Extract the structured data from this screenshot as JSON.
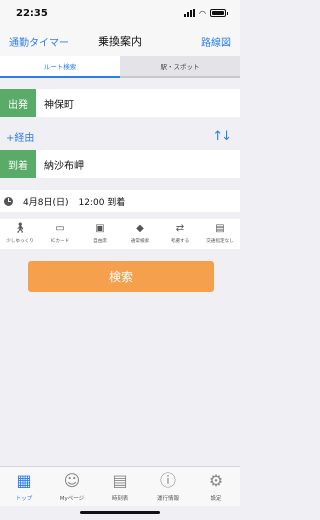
{
  "status_bar": {
    "time": "22:35"
  },
  "nav": {
    "left": "通勤タイマー",
    "title": "乗換案内",
    "right": "路線図"
  },
  "tabs": [
    {
      "label": "ルート検索",
      "active": true
    },
    {
      "label": "駅・スポット",
      "active": false
    }
  ],
  "departure": {
    "badge": "出発",
    "value": "神保町"
  },
  "via": {
    "label": "+経由"
  },
  "arrival": {
    "badge": "到着",
    "value": "納沙布岬"
  },
  "datetime": {
    "date": "4月8日(日)",
    "time": "12:00 到着"
  },
  "options": [
    {
      "label": "少しゆっくり",
      "icon": "walking-icon"
    },
    {
      "label": "ICカード",
      "icon": "ic-card-icon"
    },
    {
      "label": "自由席",
      "icon": "seat-icon"
    },
    {
      "label": "通常検索",
      "icon": "route-sign-icon"
    },
    {
      "label": "考慮する",
      "icon": "express-icon"
    },
    {
      "label": "交通指定なし",
      "icon": "bus-icon"
    }
  ],
  "search_button": "検索",
  "tabbar": [
    {
      "label": "トップ",
      "active": true
    },
    {
      "label": "Myページ",
      "active": false
    },
    {
      "label": "時刻表",
      "active": false
    },
    {
      "label": "運行情報",
      "active": false
    },
    {
      "label": "設定",
      "active": false
    }
  ],
  "colors": {
    "accent": "#2d7ee8",
    "badge": "#5aaa68",
    "search": "#f5a04c"
  }
}
